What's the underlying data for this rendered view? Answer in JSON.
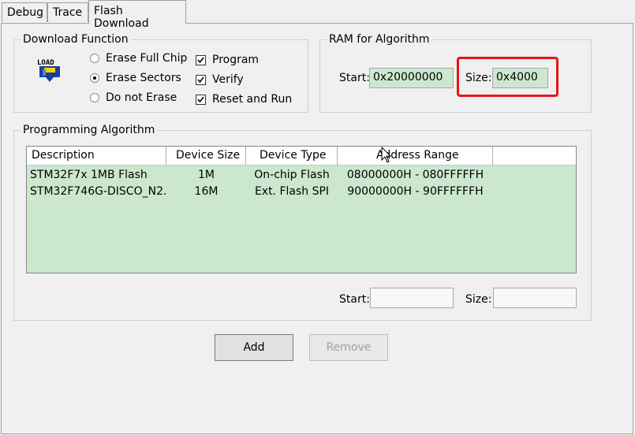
{
  "tabs": [
    {
      "label": "Debug"
    },
    {
      "label": "Trace"
    },
    {
      "label": "Flash Download",
      "active": true
    }
  ],
  "download_function": {
    "title": "Download Function",
    "icon": "load-icon",
    "icon_text": "LOAD",
    "erase_options": [
      {
        "label": "Erase Full Chip",
        "selected": false
      },
      {
        "label": "Erase Sectors",
        "selected": true
      },
      {
        "label": "Do not Erase",
        "selected": false
      }
    ],
    "actions": [
      {
        "label": "Program",
        "checked": true
      },
      {
        "label": "Verify",
        "checked": true
      },
      {
        "label": "Reset and Run",
        "checked": true
      }
    ]
  },
  "ram_for_algorithm": {
    "title": "RAM for Algorithm",
    "start_label": "Start:",
    "start_value": "0x20000000",
    "size_label": "Size:",
    "size_value": "0x4000"
  },
  "programming_algorithm": {
    "title": "Programming Algorithm",
    "columns": [
      "Description",
      "Device Size",
      "Device Type",
      "Address Range"
    ],
    "rows": [
      {
        "description": "STM32F7x 1MB Flash",
        "device_size": "1M",
        "device_type": "On-chip Flash",
        "address_range": "08000000H - 080FFFFFH"
      },
      {
        "description": "STM32F746G-DISCO_N2...",
        "device_size": "16M",
        "device_type": "Ext. Flash SPI",
        "address_range": "90000000H - 90FFFFFFH"
      }
    ],
    "start_label": "Start:",
    "start_value": "",
    "size_label": "Size:",
    "size_value": ""
  },
  "buttons": {
    "add": "Add",
    "remove": "Remove"
  },
  "colors": {
    "highlight": "#e3171b",
    "field_green": "#cbe8cf"
  }
}
